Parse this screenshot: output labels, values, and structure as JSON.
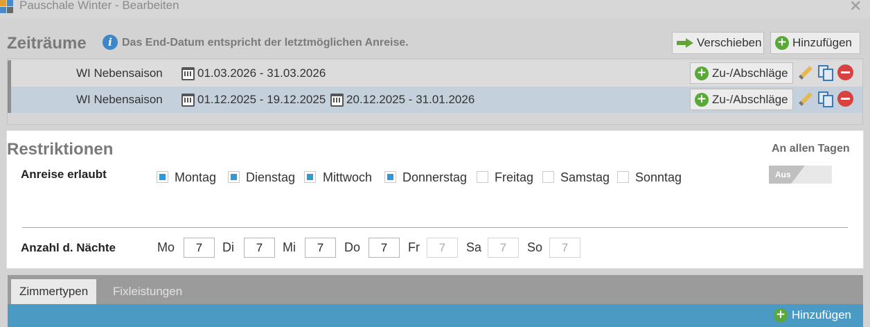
{
  "window": {
    "title": "Pauschale Winter - Bearbeiten",
    "close_glyph": "✕"
  },
  "periods": {
    "title": "Zeiträume",
    "info": "Das End-Datum entspricht der letztmöglichen Anreise.",
    "move_label": "Verschieben",
    "add_label": "Hinzufügen",
    "rows": [
      {
        "name": "WI Nebensaison",
        "ranges": [
          "01.03.2026 - 31.03.2026"
        ],
        "surcharge_label": "Zu-/Abschläge"
      },
      {
        "name": "WI Nebensaison",
        "ranges": [
          "01.12.2025 - 19.12.2025",
          "20.12.2025 - 31.01.2026"
        ],
        "surcharge_label": "Zu-/Abschläge"
      }
    ]
  },
  "restrictions": {
    "title": "Restriktionen",
    "all_days_label": "An allen Tagen",
    "toggle_label": "Aus",
    "arrival_label": "Anreise erlaubt",
    "weekdays": [
      {
        "label": "Montag",
        "checked": true
      },
      {
        "label": "Dienstag",
        "checked": true
      },
      {
        "label": "Mittwoch",
        "checked": true
      },
      {
        "label": "Donnerstag",
        "checked": true
      },
      {
        "label": "Freitag",
        "checked": false
      },
      {
        "label": "Samstag",
        "checked": false
      },
      {
        "label": "Sonntag",
        "checked": false
      }
    ],
    "nights_label": "Anzahl d. Nächte",
    "nights": [
      {
        "day": "Mo",
        "value": "7",
        "enabled": true
      },
      {
        "day": "Di",
        "value": "7",
        "enabled": true
      },
      {
        "day": "Mi",
        "value": "7",
        "enabled": true
      },
      {
        "day": "Do",
        "value": "7",
        "enabled": true
      },
      {
        "day": "Fr",
        "value": "7",
        "enabled": false
      },
      {
        "day": "Sa",
        "value": "7",
        "enabled": false
      },
      {
        "day": "So",
        "value": "7",
        "enabled": false
      }
    ]
  },
  "tabs": {
    "items": [
      "Zimmertypen",
      "Fixleistungen"
    ],
    "active": "Zimmertypen",
    "add_label": "Hinzufügen"
  },
  "colors": {
    "accent_blue": "#4a9ac3",
    "checkbox_blue": "#2e9ad6",
    "add_green": "#5ba83a",
    "remove_red": "#d94040"
  }
}
